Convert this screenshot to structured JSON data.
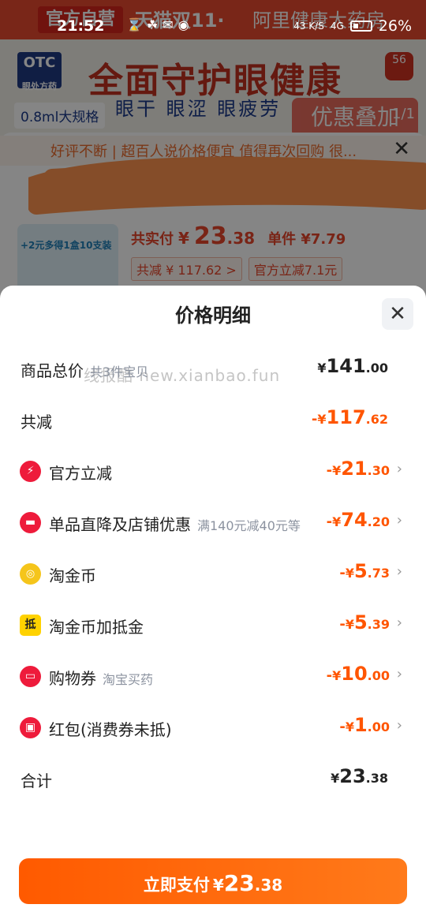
{
  "status_bar": {
    "time": "21:52",
    "network_speed": "43 K/S",
    "signal": "4G",
    "battery": "26%"
  },
  "background_page": {
    "banner_tag": "官方自营",
    "banner_event": "天猫双11·",
    "banner_store": "阿里健康大药房",
    "hero_title": "全面守护眼健康",
    "hero_subtitle": "眼干 眼涩 眼疲劳",
    "otc_badge": "OTC",
    "otc_sub": "眼处方药",
    "spec": "0.8ml大规格",
    "promo": "优惠叠加",
    "pager": "1/1",
    "cart_badge": "56",
    "notice": "好评不断 | 超百人说价格便宜 值得再次回购 很...",
    "thumb_label": "+2元多得1盒10支装",
    "price_label": "共实付",
    "price_yen": "¥",
    "price_int": "23",
    "price_dec": ".38",
    "unit_price": "单件 ¥7.79",
    "chip_reduce": "共减 ¥ 117.62 >",
    "chip_official": "官方立减7.1元"
  },
  "sheet": {
    "title": "价格明细",
    "watermark": "线报酷 new.xianbao.fun",
    "rows": [
      {
        "label": "商品总价",
        "sub": "共3件宝贝",
        "minus": "",
        "yen": "¥",
        "int": "141",
        "dec": ".00",
        "icon": ""
      },
      {
        "label": "共减",
        "sub": "",
        "minus": "-",
        "yen": "¥",
        "int": "117",
        "dec": ".62",
        "icon": ""
      },
      {
        "label": "官方立减",
        "sub": "",
        "minus": "-",
        "yen": "¥",
        "int": "21",
        "dec": ".30",
        "icon": "lightning-icon"
      },
      {
        "label": "单品直降及店铺优惠",
        "sub": "满140元减40元等",
        "minus": "-",
        "yen": "¥",
        "int": "74",
        "dec": ".20",
        "icon": "store-icon"
      },
      {
        "label": "淘金币",
        "sub": "",
        "minus": "-",
        "yen": "¥",
        "int": "5",
        "dec": ".73",
        "icon": "gold-coin-icon"
      },
      {
        "label": "淘金币加抵金",
        "sub": "",
        "minus": "-",
        "yen": "¥",
        "int": "5",
        "dec": ".39",
        "icon": "deduction-icon"
      },
      {
        "label": "购物券",
        "sub": "淘宝买药",
        "minus": "-",
        "yen": "¥",
        "int": "10",
        "dec": ".00",
        "icon": "coupon-icon"
      },
      {
        "label": "红包(消费券未抵)",
        "sub": "",
        "minus": "-",
        "yen": "¥",
        "int": "1",
        "dec": ".00",
        "icon": "red-packet-icon"
      },
      {
        "label": "合计",
        "sub": "",
        "minus": "",
        "yen": "¥",
        "int": "23",
        "dec": ".38",
        "icon": ""
      }
    ],
    "pay_button": {
      "text": "立即支付",
      "yen": "¥",
      "int": "23",
      "dec": ".38"
    },
    "colors": {
      "accent": "#ff5500",
      "icon_red": "#ee1b3b",
      "icon_gold": "#f5c51b",
      "icon_yellow": "#ffd200"
    },
    "icon_glyphs": {
      "deduction": "抵"
    }
  }
}
